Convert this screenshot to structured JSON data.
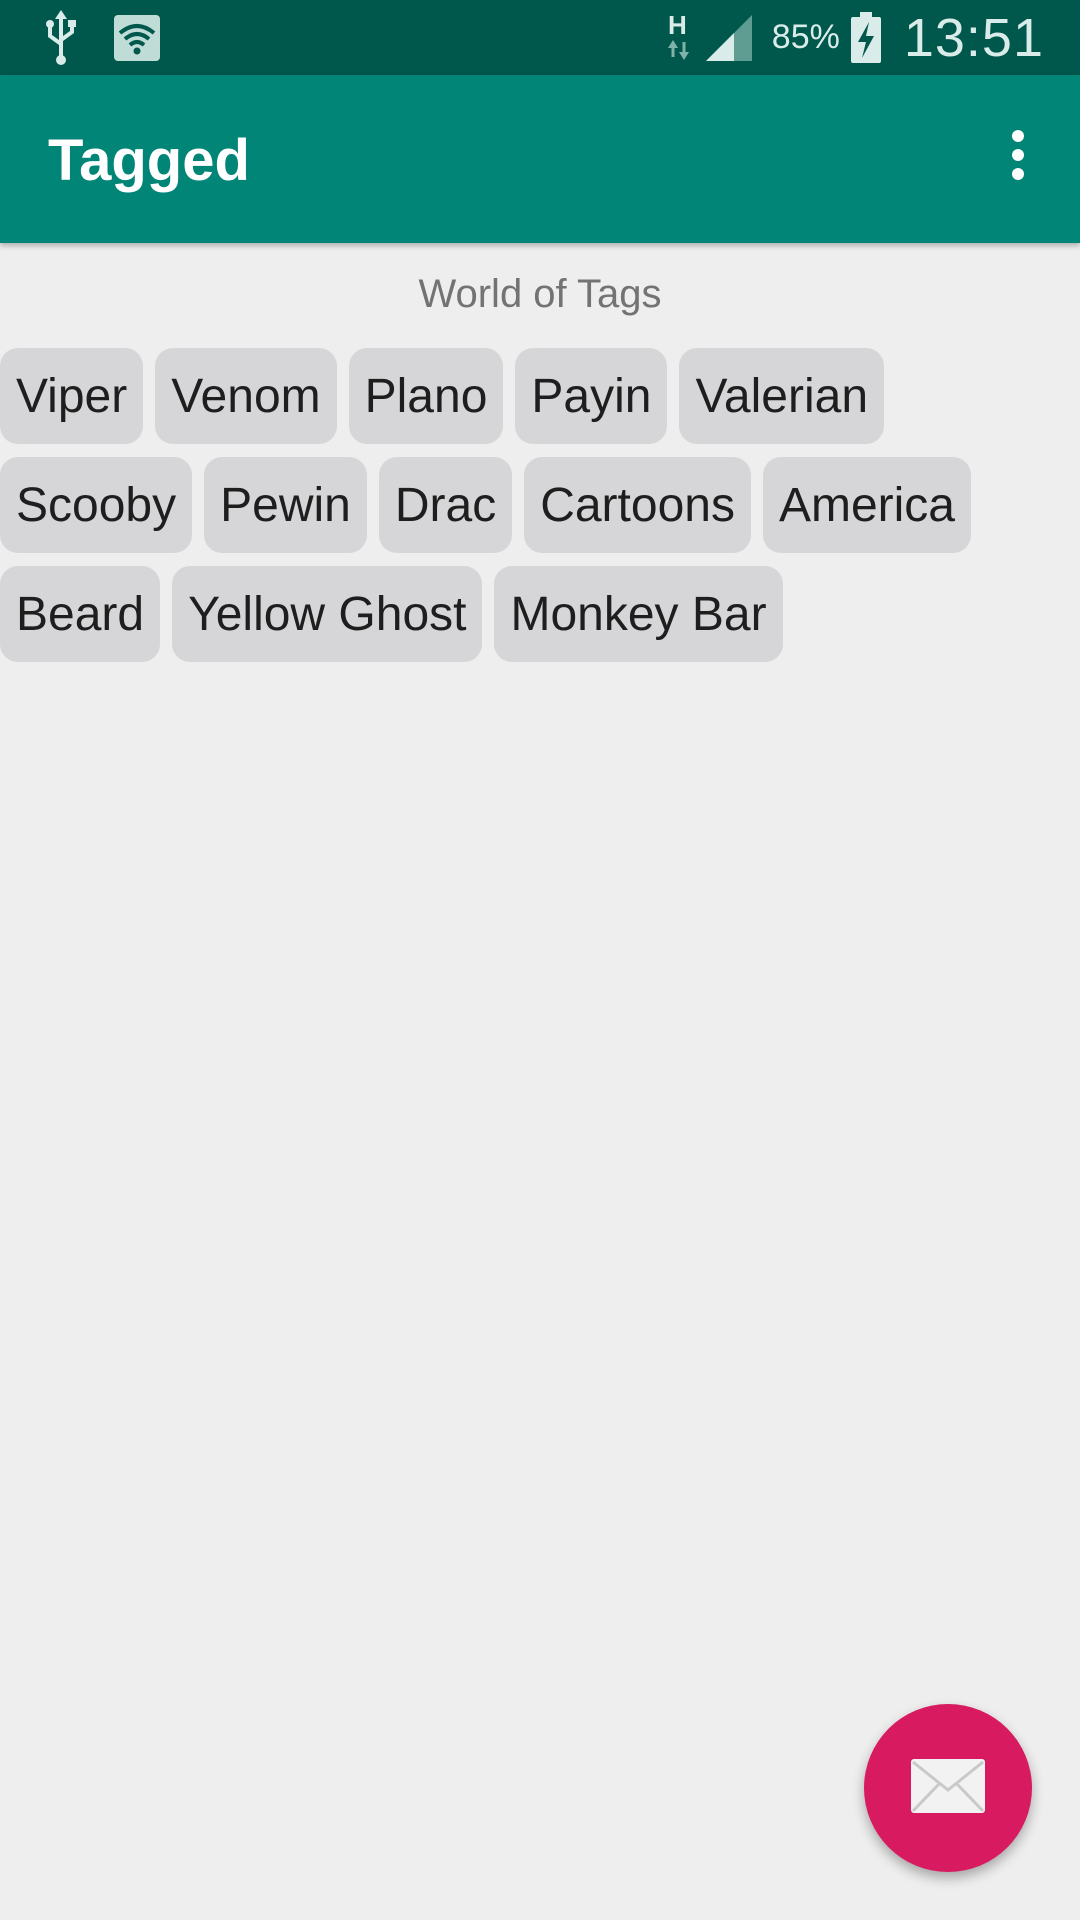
{
  "status_bar": {
    "icons": [
      "usb-icon",
      "wifi-icon",
      "h-network-icon",
      "signal-icon",
      "battery-charging-icon"
    ],
    "battery_percent": "85%",
    "time": "13:51"
  },
  "app_bar": {
    "title": "Tagged",
    "menu_icon": "more-vert-icon"
  },
  "content": {
    "subtitle": "World of Tags",
    "tag_rows": [
      [
        "Viper",
        "Venom",
        "Plano",
        "Payin",
        "Valerian"
      ],
      [
        "Scooby",
        "Pewin",
        "Drac",
        "Cartoons",
        "America"
      ],
      [
        "Beard",
        "Yellow Ghost",
        "Monkey Bar"
      ]
    ]
  },
  "fab": {
    "icon": "mail-icon",
    "color": "#d81b60"
  },
  "colors": {
    "status_bar": "#00574b",
    "app_bar": "#008577",
    "background": "#eeeeee",
    "tag_background": "#d6d5d7",
    "accent": "#d81b60"
  }
}
